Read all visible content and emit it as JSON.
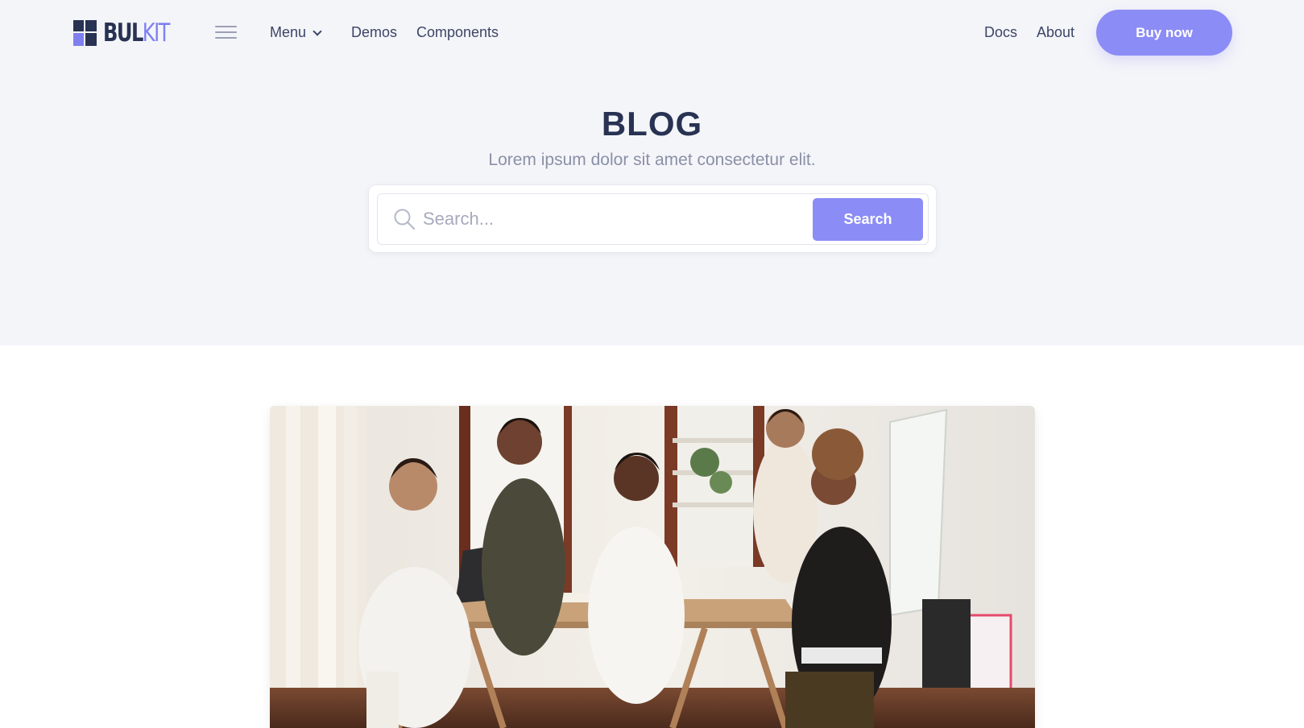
{
  "navbar": {
    "logo_text_dark": "BUL",
    "logo_text_accent": "KIT",
    "links": {
      "menu": "Menu",
      "demos": "Demos",
      "components": "Components",
      "docs": "Docs",
      "about": "About"
    },
    "buy_label": "Buy now"
  },
  "hero": {
    "title": "BLOG",
    "subtitle": "Lorem ipsum dolor sit amet consectetur elit.",
    "search": {
      "placeholder": "Search...",
      "value": "",
      "button_label": "Search"
    }
  },
  "icons": {
    "burger": "hamburger-menu-icon",
    "menu_caret": "chevron-down-icon",
    "search": "search-icon"
  },
  "colors": {
    "accent": "#8c8cf6",
    "heading": "#283252",
    "hero_bg": "#f4f5f9",
    "muted_text": "#8a90a6"
  }
}
